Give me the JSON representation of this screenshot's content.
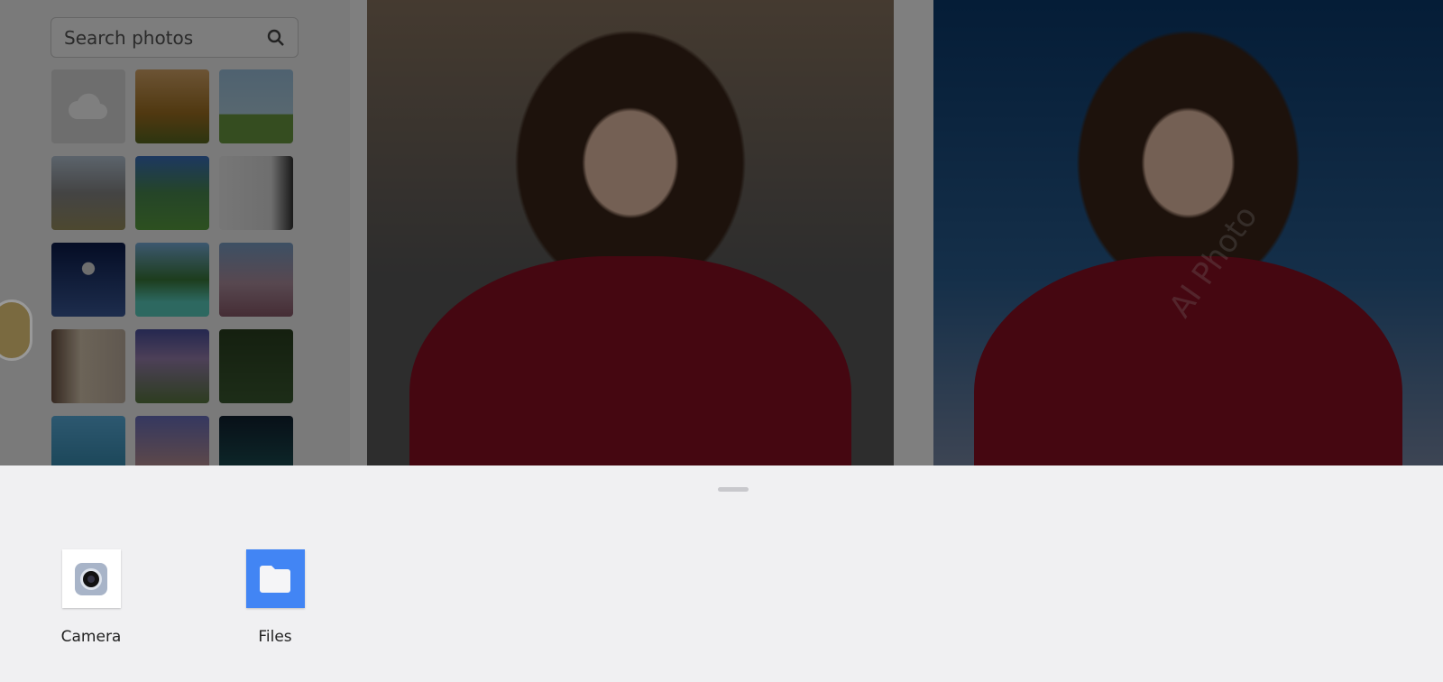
{
  "background_app": {
    "search": {
      "placeholder": "Search photos",
      "icon": "search-icon"
    },
    "watermark": "AI Photo"
  },
  "sheet": {
    "apps": [
      {
        "label": "Camera",
        "icon": "camera-icon"
      },
      {
        "label": "Files",
        "icon": "folder-icon",
        "color": "#4285f4"
      }
    ]
  }
}
